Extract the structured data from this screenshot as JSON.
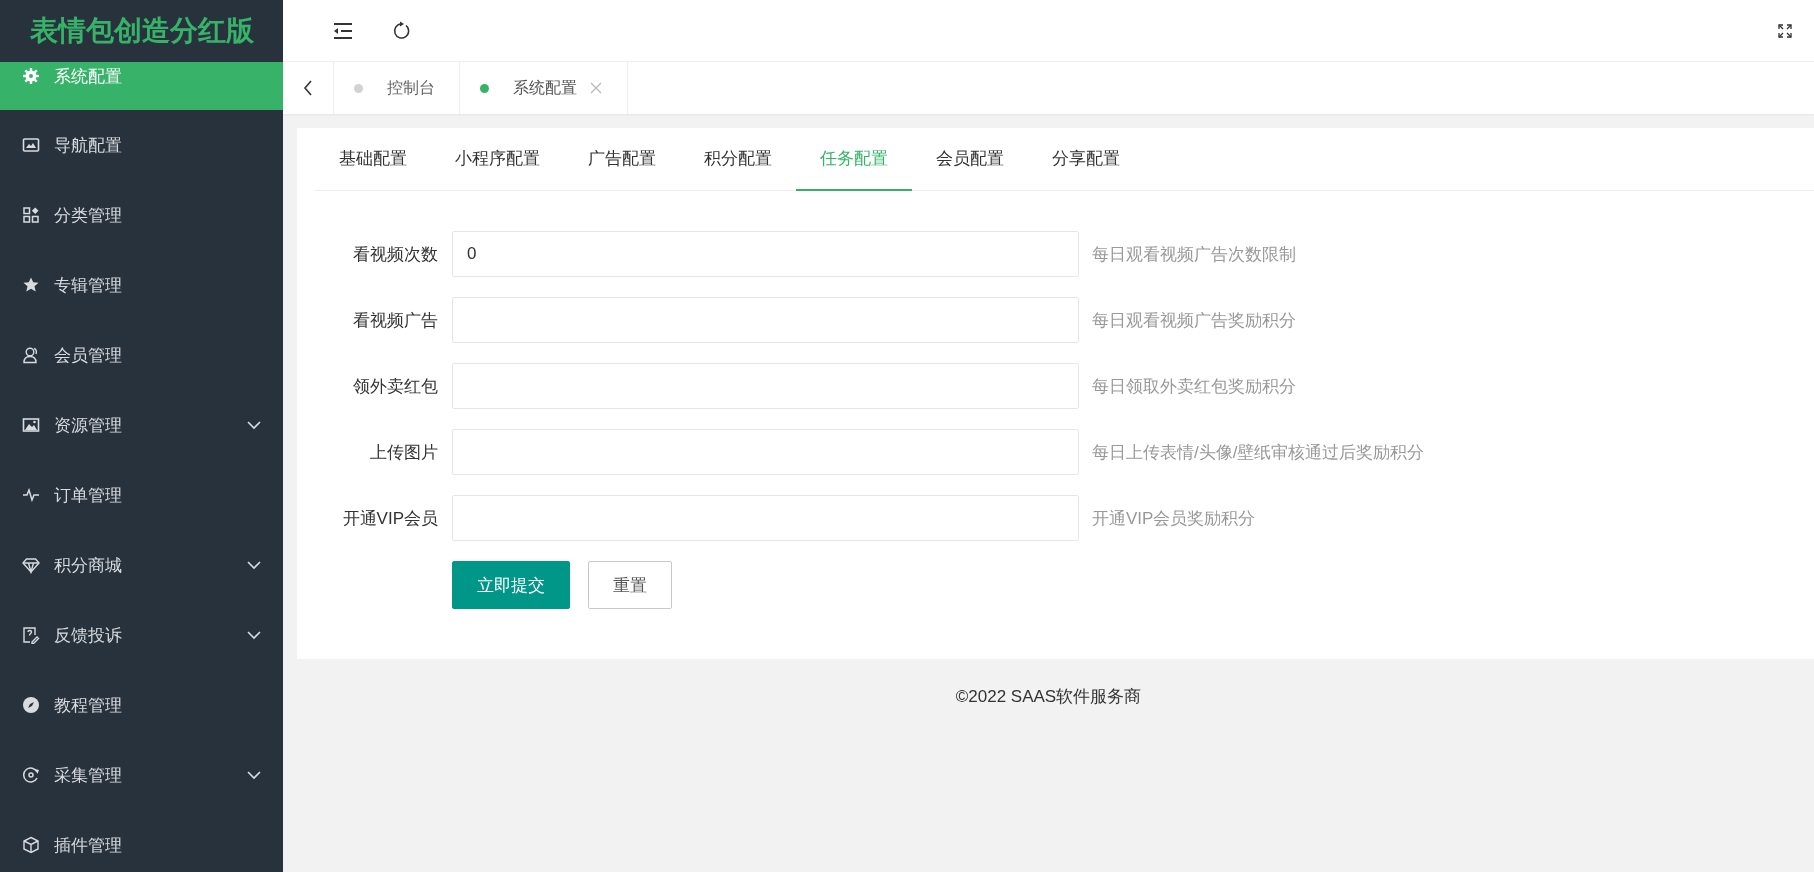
{
  "sidebar": {
    "logo": "表情包创造分红版",
    "items": [
      {
        "label": "系统配置",
        "selected": true,
        "expandable": false
      },
      {
        "label": "导航配置",
        "selected": false,
        "expandable": false
      },
      {
        "label": "分类管理",
        "selected": false,
        "expandable": false
      },
      {
        "label": "专辑管理",
        "selected": false,
        "expandable": false
      },
      {
        "label": "会员管理",
        "selected": false,
        "expandable": false
      },
      {
        "label": "资源管理",
        "selected": false,
        "expandable": true
      },
      {
        "label": "订单管理",
        "selected": false,
        "expandable": false
      },
      {
        "label": "积分商城",
        "selected": false,
        "expandable": true
      },
      {
        "label": "反馈投诉",
        "selected": false,
        "expandable": true
      },
      {
        "label": "教程管理",
        "selected": false,
        "expandable": false
      },
      {
        "label": "采集管理",
        "selected": false,
        "expandable": true
      },
      {
        "label": "插件管理",
        "selected": false,
        "expandable": false
      }
    ]
  },
  "page_tabs": [
    {
      "label": "控制台",
      "selected": false,
      "closable": false
    },
    {
      "label": "系统配置",
      "selected": true,
      "closable": true
    }
  ],
  "config_tabs": [
    {
      "label": "基础配置",
      "selected": false
    },
    {
      "label": "小程序配置",
      "selected": false
    },
    {
      "label": "广告配置",
      "selected": false
    },
    {
      "label": "积分配置",
      "selected": false
    },
    {
      "label": "任务配置",
      "selected": true
    },
    {
      "label": "会员配置",
      "selected": false
    },
    {
      "label": "分享配置",
      "selected": false
    }
  ],
  "form": {
    "fields": [
      {
        "label": "看视频次数",
        "value": "0",
        "hint": "每日观看视频广告次数限制"
      },
      {
        "label": "看视频广告",
        "hint": "每日观看视频广告奖励积分"
      },
      {
        "label": "领外卖红包",
        "hint": "每日领取外卖红包奖励积分"
      },
      {
        "label": "上传图片",
        "hint": "每日上传表情/头像/壁纸审核通过后奖励积分"
      },
      {
        "label": "开通VIP会员",
        "hint": "开通VIP会员奖励积分"
      }
    ],
    "buttons": [
      {
        "label": "立即提交",
        "kind": "primary"
      },
      {
        "label": "重置",
        "kind": "secondary"
      }
    ]
  },
  "footer": "©2022 SAAS软件服务商"
}
